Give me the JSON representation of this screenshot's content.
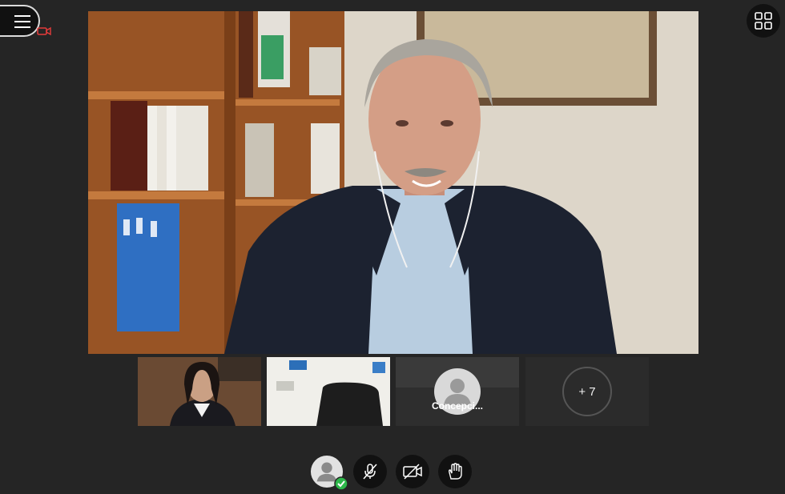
{
  "participants": {
    "tiles": [
      {
        "name": ""
      },
      {
        "name": ""
      },
      {
        "name": "Concepci..."
      }
    ],
    "more_label": "+ 7"
  },
  "controls": {
    "items": [
      "self-avatar",
      "mute-microphone",
      "disable-camera",
      "raise-hand"
    ]
  },
  "colors": {
    "background": "#252525",
    "control_bg": "#111111",
    "status_ok": "#2db84a",
    "recording": "#e33b3b"
  }
}
